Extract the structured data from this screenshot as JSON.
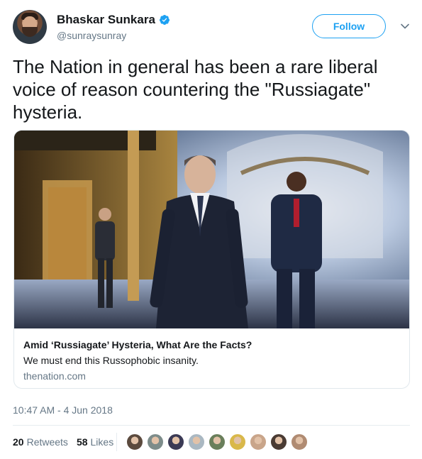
{
  "user": {
    "display_name": "Bhaskar Sunkara",
    "handle": "@sunraysunray",
    "verified_icon": "verified-badge-icon"
  },
  "follow_label": "Follow",
  "tweet_text": "The Nation in general has been a rare liberal voice of reason countering the \"Russiagate\" hysteria.",
  "card": {
    "title": "Amid ‘Russiagate’ Hysteria, What Are the Facts?",
    "description": "We must end this Russophobic insanity.",
    "domain": "thenation.com"
  },
  "timestamp": "10:47 AM - 4 Jun 2018",
  "stats": {
    "retweets_count": "20",
    "retweets_label": "Retweets",
    "likes_count": "58",
    "likes_label": "Likes"
  },
  "liker_colors": [
    "#5b4a3e",
    "#7d8c8a",
    "#3b3a55",
    "#aab8c2",
    "#6a7f5b",
    "#d9b84a",
    "#c9a58a",
    "#4a3b33",
    "#b08b72"
  ],
  "colors": {
    "accent": "#1da1f2",
    "text": "#14171a",
    "secondary": "#657786"
  }
}
